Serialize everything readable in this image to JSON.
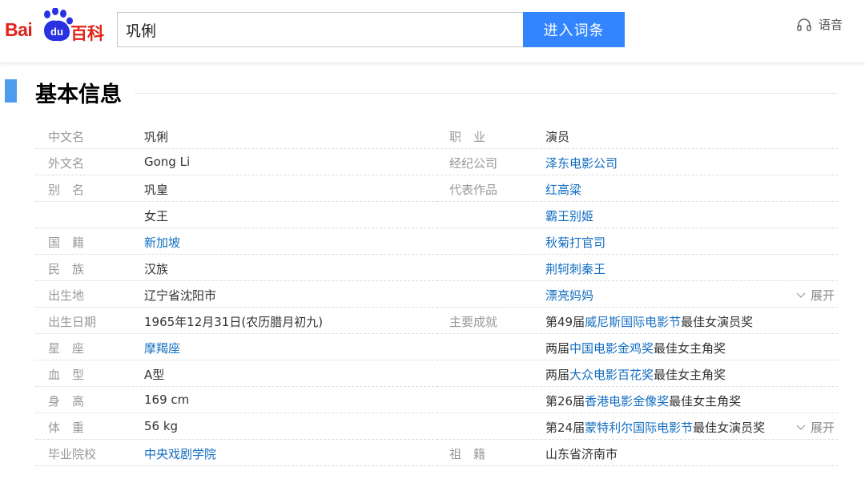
{
  "header": {
    "logo": {
      "bai": "Bai",
      "du": "du",
      "baike": "百科"
    },
    "search_value": "巩俐",
    "search_button": "进入词条",
    "voice_label": "语音"
  },
  "section": {
    "title": "基本信息"
  },
  "expand_label": "展开",
  "colors": {
    "link": "#136ec2",
    "accent": "#3385ff",
    "brand": "#e2231a",
    "section_bar": "#4f9cee"
  },
  "left_rows": [
    {
      "label": "中文名",
      "parts": [
        {
          "text": "巩俐",
          "link": false
        }
      ]
    },
    {
      "label": "外文名",
      "parts": [
        {
          "text": "Gong Li",
          "link": false
        }
      ]
    },
    {
      "label": "别　名",
      "parts": [
        {
          "text": "巩皇",
          "link": false
        }
      ]
    },
    {
      "label": "",
      "parts": [
        {
          "text": "女王",
          "link": false
        }
      ]
    },
    {
      "label": "国　籍",
      "parts": [
        {
          "text": "新加坡",
          "link": true
        }
      ]
    },
    {
      "label": "民　族",
      "parts": [
        {
          "text": "汉族",
          "link": false
        }
      ]
    },
    {
      "label": "出生地",
      "parts": [
        {
          "text": "辽宁省沈阳市",
          "link": false
        }
      ]
    },
    {
      "label": "出生日期",
      "parts": [
        {
          "text": "1965年12月31日(农历腊月初九)",
          "link": false
        }
      ]
    },
    {
      "label": "星　座",
      "parts": [
        {
          "text": "摩羯座",
          "link": true
        }
      ]
    },
    {
      "label": "血　型",
      "parts": [
        {
          "text": "A型",
          "link": false
        }
      ]
    },
    {
      "label": "身　高",
      "parts": [
        {
          "text": "169 cm",
          "link": false
        }
      ]
    },
    {
      "label": "体　重",
      "parts": [
        {
          "text": "56 kg",
          "link": false
        }
      ]
    },
    {
      "label": "毕业院校",
      "parts": [
        {
          "text": "中央戏剧学院",
          "link": true
        }
      ]
    }
  ],
  "right_rows": [
    {
      "label": "职　业",
      "parts": [
        {
          "text": "演员",
          "link": false
        }
      ]
    },
    {
      "label": "经纪公司",
      "parts": [
        {
          "text": "泽东电影公司",
          "link": true
        }
      ]
    },
    {
      "label": "代表作品",
      "parts": [
        {
          "text": "红高粱",
          "link": true
        }
      ]
    },
    {
      "label": "",
      "parts": [
        {
          "text": "霸王别姬",
          "link": true
        }
      ]
    },
    {
      "label": "",
      "parts": [
        {
          "text": "秋菊打官司",
          "link": true
        }
      ]
    },
    {
      "label": "",
      "parts": [
        {
          "text": "荆轲刺秦王",
          "link": true
        }
      ]
    },
    {
      "label": "",
      "parts": [
        {
          "text": "漂亮妈妈",
          "link": true
        }
      ],
      "expand": true
    },
    {
      "label": "主要成就",
      "parts": [
        {
          "text": "第49届",
          "link": false
        },
        {
          "text": "威尼斯国际电影节",
          "link": true
        },
        {
          "text": "最佳女演员奖",
          "link": false
        }
      ]
    },
    {
      "label": "",
      "parts": [
        {
          "text": "两届",
          "link": false
        },
        {
          "text": "中国电影金鸡奖",
          "link": true
        },
        {
          "text": "最佳女主角奖",
          "link": false
        }
      ]
    },
    {
      "label": "",
      "parts": [
        {
          "text": "两届",
          "link": false
        },
        {
          "text": "大众电影百花奖",
          "link": true
        },
        {
          "text": "最佳女主角奖",
          "link": false
        }
      ]
    },
    {
      "label": "",
      "parts": [
        {
          "text": "第26届",
          "link": false
        },
        {
          "text": "香港电影金像奖",
          "link": true
        },
        {
          "text": "最佳女主角奖",
          "link": false
        }
      ]
    },
    {
      "label": "",
      "parts": [
        {
          "text": "第24届",
          "link": false
        },
        {
          "text": "蒙特利尔国际电影节",
          "link": true
        },
        {
          "text": "最佳女演员奖",
          "link": false
        }
      ],
      "expand": true
    },
    {
      "label": "祖　籍",
      "parts": [
        {
          "text": "山东省济南市",
          "link": false
        }
      ]
    }
  ]
}
